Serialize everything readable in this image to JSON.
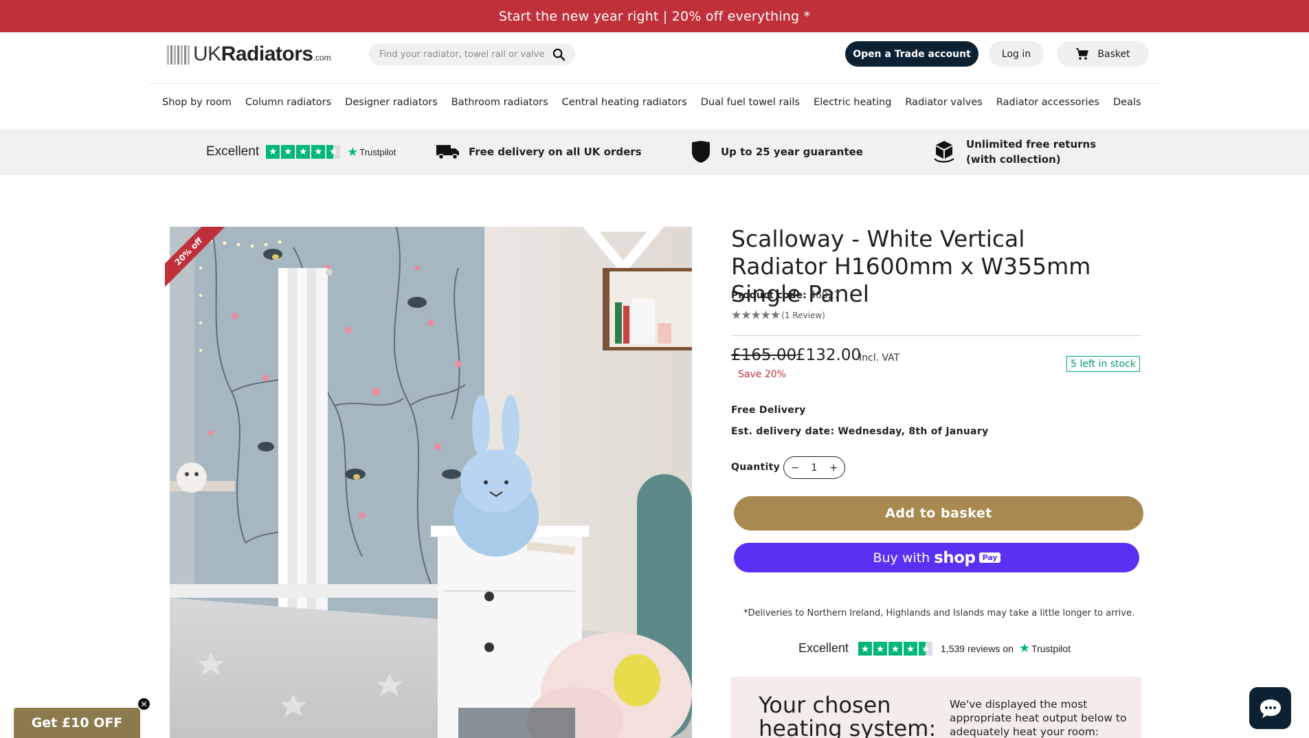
{
  "promo_bar": {
    "text": "Start the new year right | 20% off everything *"
  },
  "header": {
    "logo": {
      "uk": "UK",
      "radiators": "Radiators",
      "com": ".com"
    },
    "search": {
      "placeholder": "Find your radiator, towel rail or valve",
      "value": ""
    },
    "trade_button": "Open a Trade account",
    "login_button": "Log in",
    "basket_button": "Basket"
  },
  "nav": {
    "items": [
      "Shop by room",
      "Column radiators",
      "Designer radiators",
      "Bathroom radiators",
      "Central heating radiators",
      "Dual fuel towel rails",
      "Electric heating",
      "Radiator valves",
      "Radiator accessories",
      "Deals"
    ]
  },
  "usp": {
    "trustpilot_word": "Excellent",
    "trustpilot_brand": "Trustpilot",
    "delivery": "Free delivery on all UK orders",
    "guarantee": "Up to 25 year guarantee",
    "returns_line1": "Unlimited free returns",
    "returns_line2": "(with collection)"
  },
  "gallery": {
    "badge": "20% off"
  },
  "product": {
    "title": "Scalloway - White Vertical Radiator H1600mm x W355mm Single Panel",
    "code_label": "Product code:",
    "code_value": "46027",
    "rating_stars": 5,
    "review_count": "(1 Review)",
    "price_old": "£165.00",
    "price_new": "£132.00",
    "incl_vat": "Incl. VAT",
    "save": "Save 20%",
    "stock": "5 left in stock",
    "free_delivery": "Free Delivery",
    "est_delivery": "Est. delivery date: Wednesday, 8th of January",
    "quantity_label": "Quantity",
    "quantity_value": "1",
    "add_button": "Add to basket",
    "shop_pay_prefix": "Buy with",
    "shop_pay_brand": "shop",
    "shop_pay_badge": "Pay",
    "delivery_note": "*Deliveries to Northern Ireland, Highlands and Islands may take a little longer to arrive.",
    "trustpilot_word": "Excellent",
    "trustpilot_reviews": "1,539 reviews on",
    "trustpilot_brand": "Trustpilot"
  },
  "heating_box": {
    "heading": "Your chosen heating system:",
    "text": "We've displayed the most appropriate heat output below to adequately heat your room:"
  },
  "promo_float": {
    "label": "Get £10 OFF"
  },
  "colors": {
    "promo_red": "#c0303a",
    "navy": "#0c2233",
    "gold": "#a8894f",
    "shop_pay_purple": "#5a31f4",
    "trustpilot_green": "#00b67a",
    "stock_green": "#009b63"
  }
}
